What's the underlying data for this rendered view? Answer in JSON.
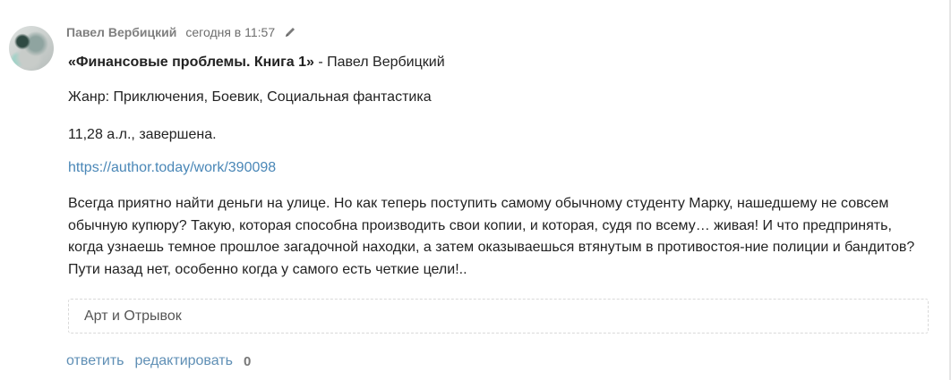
{
  "comment": {
    "author": "Павел Вербицкий",
    "date": "сегодня в 11:57",
    "book_title": "«Финансовые проблемы. Книга 1»",
    "book_author_suffix": " - Павел Вербицкий",
    "genre": "Жанр: Приключения, Боевик, Социальная фантастика",
    "size": "11,28 а.л., завершена.",
    "link": "https://author.today/work/390098",
    "description": "Всегда приятно найти деньги на улице. Но как теперь поступить самому обычному студенту Марку, нашедшему не совсем обычную купюру? Такую, которая способна производить свои копии, и которая, судя по всему… живая! И что предпринять, когда узнаешь темное прошлое загадочной находки, а затем оказываешься втянутым в противостоя-ние полиции и бандитов? Пути назад нет, особенно когда у самого есть четкие цели!..",
    "spoiler_label": "Арт и Отрывок",
    "actions": {
      "reply": "ответить",
      "edit": "редактировать",
      "rating": "0"
    }
  },
  "colors": {
    "link": "#4a87b7",
    "author": "#7f7f7f"
  },
  "icons": {
    "edit": "pencil-icon"
  }
}
